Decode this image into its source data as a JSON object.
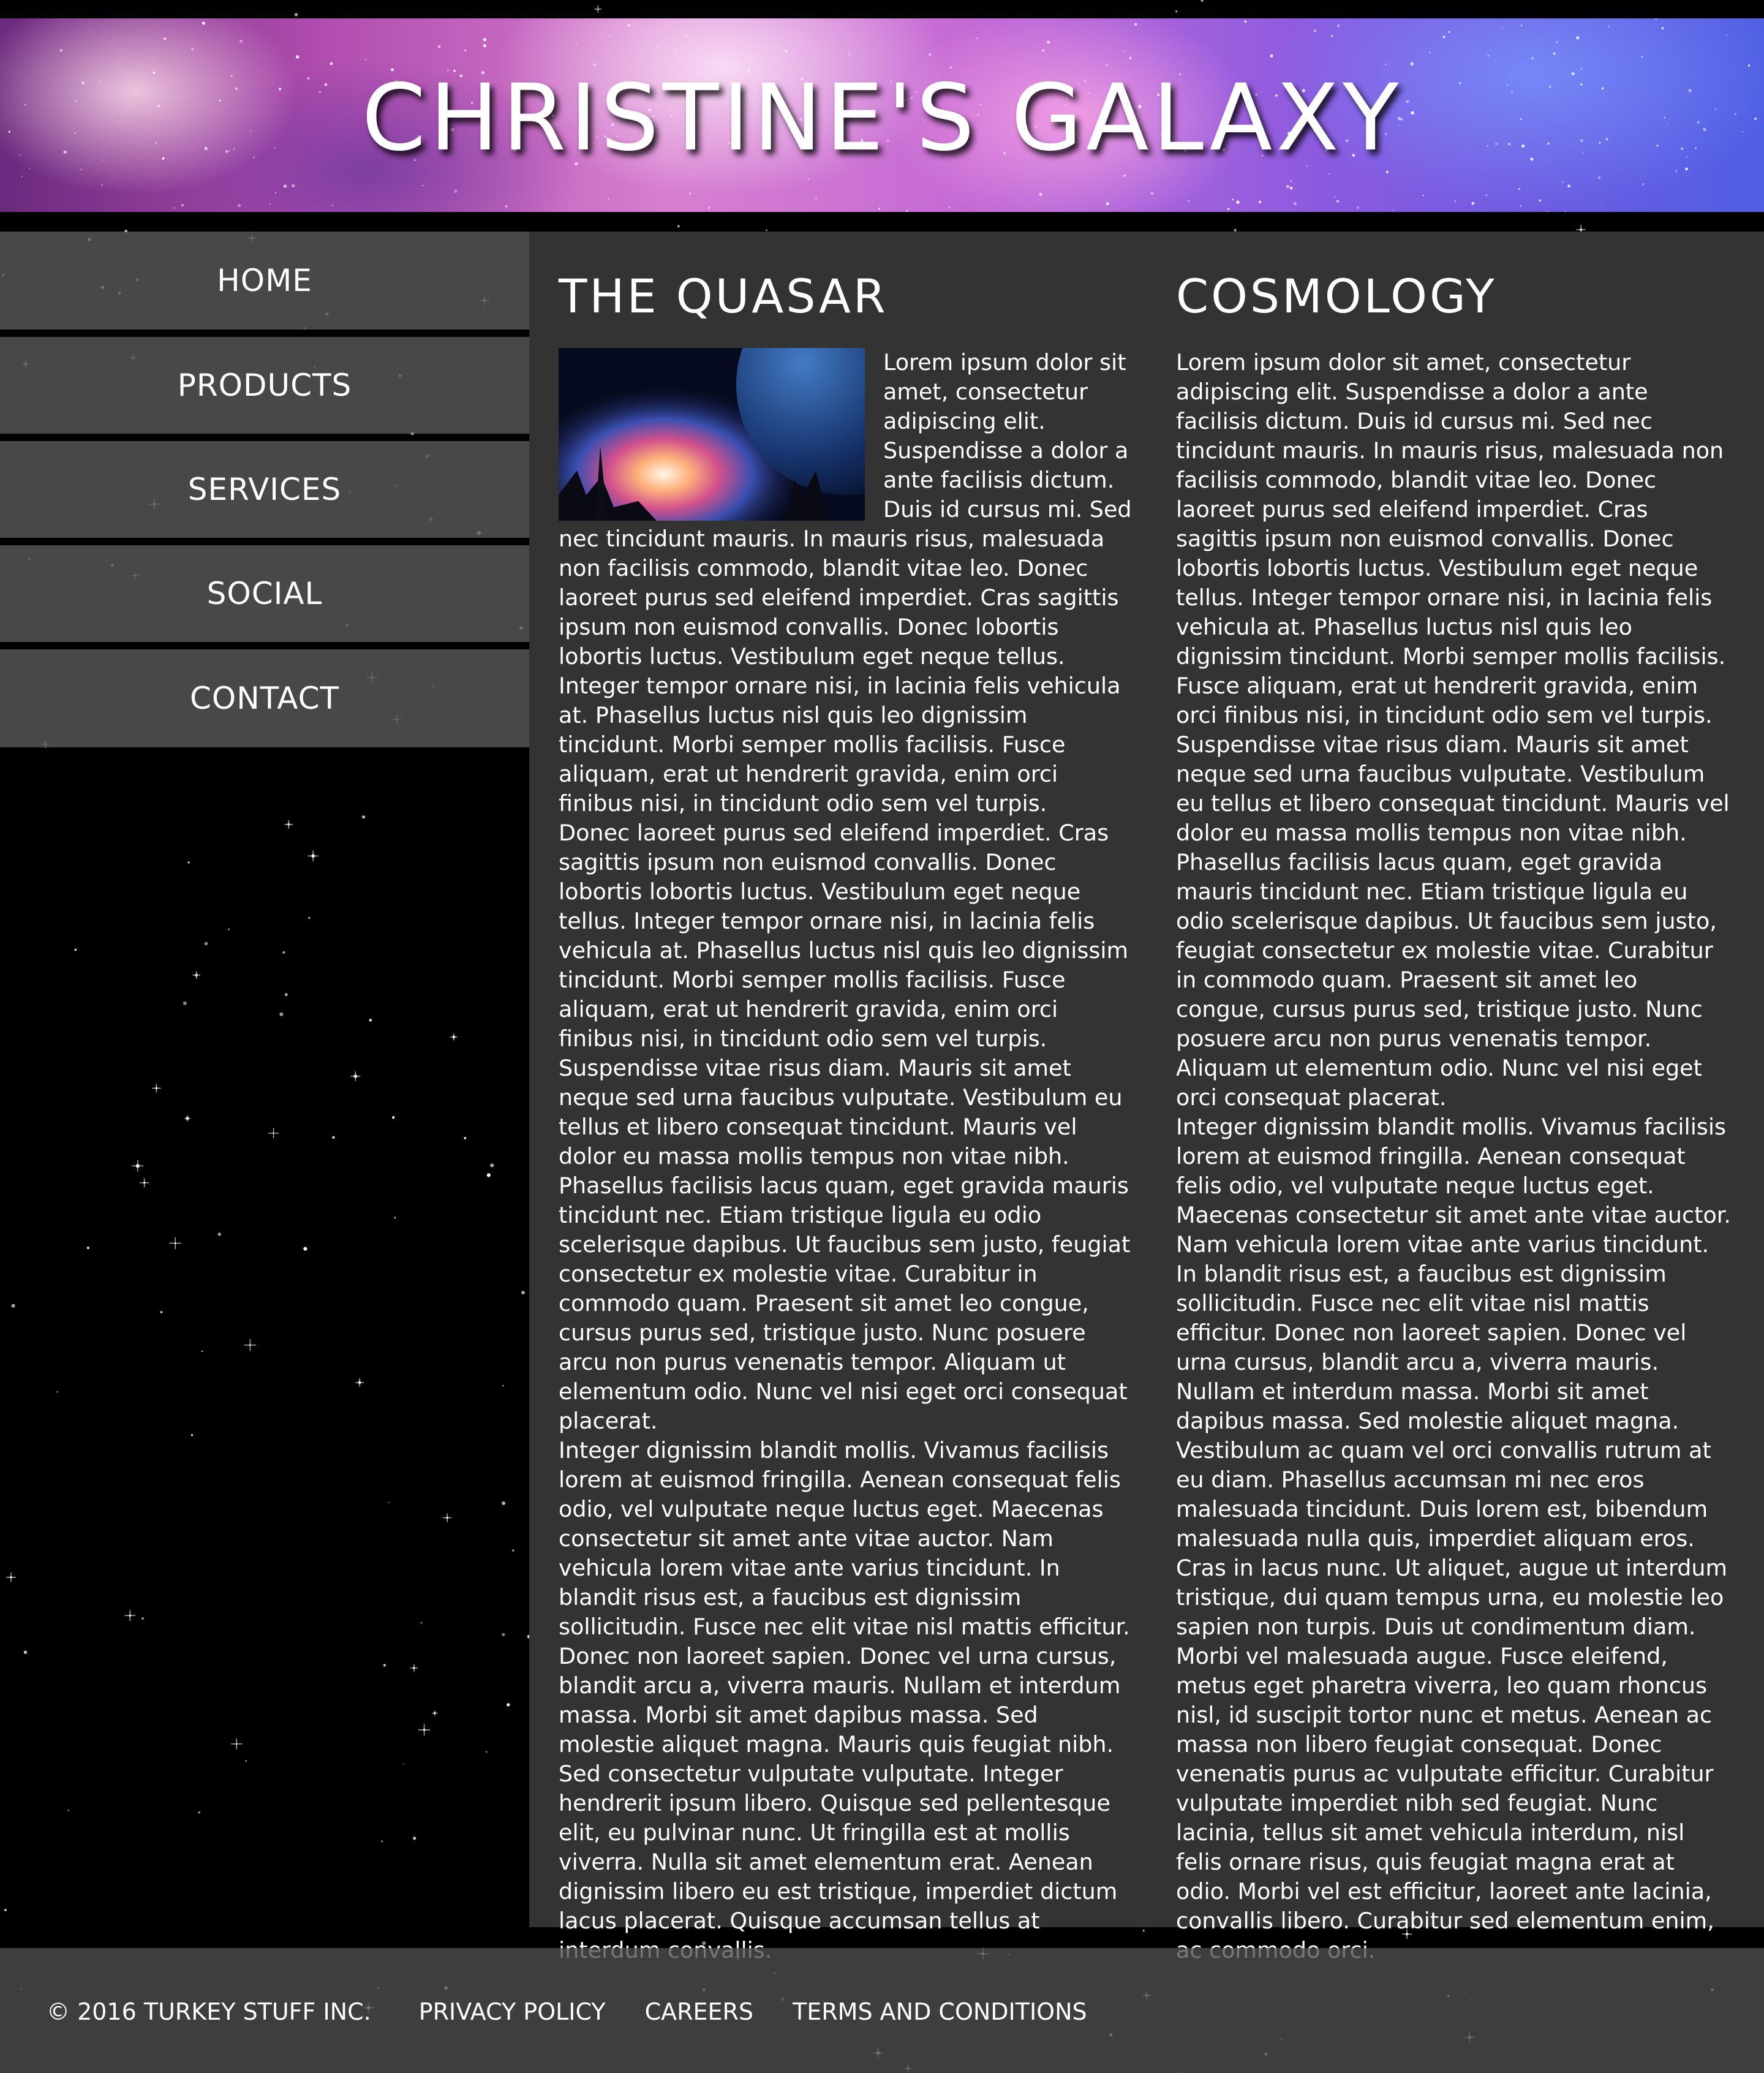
{
  "header": {
    "title": "CHRISTINE'S GALAXY"
  },
  "nav": {
    "items": [
      {
        "label": "HOME"
      },
      {
        "label": "PRODUCTS"
      },
      {
        "label": "SERVICES"
      },
      {
        "label": "SOCIAL"
      },
      {
        "label": "CONTACT"
      }
    ]
  },
  "main": {
    "left": {
      "heading": "THE QUASAR",
      "paragraphs": [
        "Lorem ipsum dolor sit amet, consectetur adipiscing elit. Suspendisse a dolor a ante facilisis dictum. Duis id cursus mi. Sed nec tincidunt mauris. In mauris risus, malesuada non facilisis commodo, blandit vitae leo. Donec laoreet purus sed eleifend imperdiet. Cras sagittis ipsum non euismod convallis. Donec lobortis lobortis luctus. Vestibulum eget neque tellus. Integer tempor ornare nisi, in lacinia felis vehicula at. Phasellus luctus nisl quis leo dignissim tincidunt. Morbi semper mollis facilisis. Fusce aliquam, erat ut hendrerit gravida, enim orci finibus nisi, in tincidunt odio sem vel turpis.",
        "Donec laoreet purus sed eleifend imperdiet. Cras sagittis ipsum non euismod convallis. Donec lobortis lobortis luctus. Vestibulum eget neque tellus. Integer tempor ornare nisi, in lacinia felis vehicula at. Phasellus luctus nisl quis leo dignissim tincidunt. Morbi semper mollis facilisis. Fusce aliquam, erat ut hendrerit gravida, enim orci finibus nisi, in tincidunt odio sem vel turpis.",
        "Suspendisse vitae risus diam. Mauris sit amet neque sed urna faucibus vulputate. Vestibulum eu tellus et libero consequat tincidunt. Mauris vel dolor eu massa mollis tempus non vitae nibh. Phasellus facilisis lacus quam, eget gravida mauris tincidunt nec. Etiam tristique ligula eu odio scelerisque dapibus. Ut faucibus sem justo, feugiat consectetur ex molestie vitae. Curabitur in commodo quam. Praesent sit amet leo congue, cursus purus sed, tristique justo. Nunc posuere arcu non purus venenatis tempor. Aliquam ut elementum odio. Nunc vel nisi eget orci consequat placerat.",
        "Integer dignissim blandit mollis. Vivamus facilisis lorem at euismod fringilla. Aenean consequat felis odio, vel vulputate neque luctus eget. Maecenas consectetur sit amet ante vitae auctor. Nam vehicula lorem vitae ante varius tincidunt. In blandit risus est, a faucibus est dignissim sollicitudin. Fusce nec elit vitae nisl mattis efficitur. Donec non laoreet sapien. Donec vel urna cursus, blandit arcu a, viverra mauris. Nullam et interdum massa. Morbi sit amet dapibus massa. Sed molestie aliquet magna. Mauris quis feugiat nibh. Sed consectetur vulputate vulputate. Integer hendrerit ipsum libero. Quisque sed pellentesque elit, eu pulvinar nunc. Ut fringilla est at mollis viverra. Nulla sit amet elementum erat. Aenean dignissim libero eu est tristique, imperdiet dictum lacus placerat. Quisque accumsan tellus at interdum convallis."
      ]
    },
    "right": {
      "heading": "COSMOLOGY",
      "paragraphs": [
        "Lorem ipsum dolor sit amet, consectetur adipiscing elit. Suspendisse a dolor a ante facilisis dictum. Duis id cursus mi. Sed nec tincidunt mauris. In mauris risus, malesuada non facilisis commodo, blandit vitae leo. Donec laoreet purus sed eleifend imperdiet. Cras sagittis ipsum non euismod convallis. Donec lobortis lobortis luctus. Vestibulum eget neque tellus. Integer tempor ornare nisi, in lacinia felis vehicula at. Phasellus luctus nisl quis leo dignissim tincidunt. Morbi semper mollis facilisis. Fusce aliquam, erat ut hendrerit gravida, enim orci finibus nisi, in tincidunt odio sem vel turpis.",
        "Suspendisse vitae risus diam. Mauris sit amet neque sed urna faucibus vulputate. Vestibulum eu tellus et libero consequat tincidunt. Mauris vel dolor eu massa mollis tempus non vitae nibh. Phasellus facilisis lacus quam, eget gravida mauris tincidunt nec. Etiam tristique ligula eu odio scelerisque dapibus. Ut faucibus sem justo, feugiat consectetur ex molestie vitae. Curabitur in commodo quam. Praesent sit amet leo congue, cursus purus sed, tristique justo. Nunc posuere arcu non purus venenatis tempor. Aliquam ut elementum odio. Nunc vel nisi eget orci consequat placerat.",
        "Integer dignissim blandit mollis. Vivamus facilisis lorem at euismod fringilla. Aenean consequat felis odio, vel vulputate neque luctus eget. Maecenas consectetur sit amet ante vitae auctor. Nam vehicula lorem vitae ante varius tincidunt. In blandit risus est, a faucibus est dignissim sollicitudin. Fusce nec elit vitae nisl mattis efficitur. Donec non laoreet sapien. Donec vel urna cursus, blandit arcu a, viverra mauris. Nullam et interdum massa. Morbi sit amet dapibus massa. Sed molestie aliquet magna. Vestibulum ac quam vel orci convallis rutrum at eu diam. Phasellus accumsan mi nec eros malesuada tincidunt. Duis lorem est, bibendum malesuada nulla quis, imperdiet aliquam eros. Cras in lacus nunc. Ut aliquet, augue ut interdum tristique, dui quam tempus urna, eu molestie leo sapien non turpis. Duis ut condimentum diam. Morbi vel malesuada augue. Fusce eleifend, metus eget pharetra viverra, leo quam rhoncus nisl, id suscipit tortor nunc et metus. Aenean ac massa non libero feugiat consequat. Donec venenatis purus ac vulputate efficitur. Curabitur vulputate imperdiet nibh sed feugiat. Nunc lacinia, tellus sit amet vehicula interdum, nisl felis ornare risus, quis feugiat magna erat at odio. Morbi vel est efficitur, laoreet ante lacinia, convallis libero. Curabitur sed elementum enim, ac commodo orci."
      ]
    }
  },
  "footer": {
    "copyright": "© 2016 TURKEY STUFF INC.",
    "links": [
      {
        "label": "PRIVACY POLICY"
      },
      {
        "label": "CAREERS"
      },
      {
        "label": "TERMS AND CONDITIONS"
      }
    ]
  }
}
